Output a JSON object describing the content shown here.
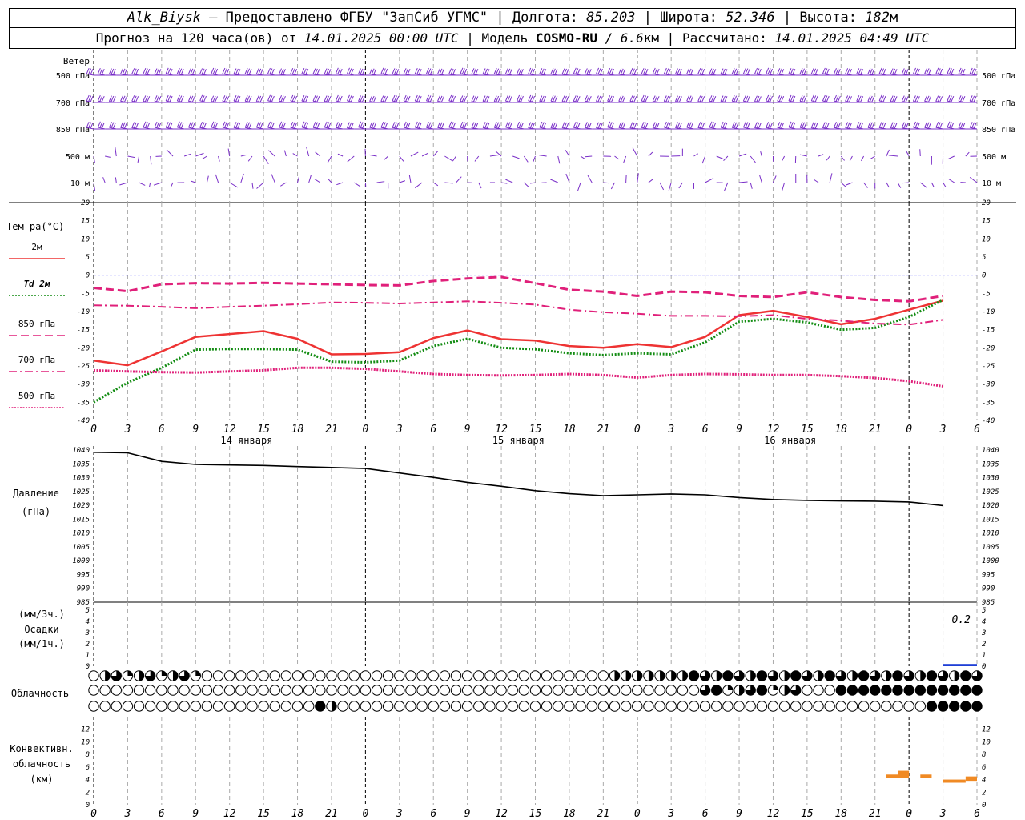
{
  "header": {
    "station": "Alk_Biysk",
    "provider": "— Предоставлено ФГБУ \"ЗапСиб УГМС\"",
    "sep": "|",
    "lon_label": "Долгота:",
    "lon": "85.203",
    "lat_label": "Широта:",
    "lat": "52.346",
    "alt_label": "Высота:",
    "alt": "182",
    "alt_unit": "м",
    "forecast_label": "Прогноз на 120 часа(ов) от",
    "forecast_start": "14.01.2025 00:00 UTC",
    "model_label": "| Модель",
    "model": "COSMO-RU",
    "model_res": "/ 6.6",
    "model_res_unit": "км",
    "calc_label": "| Рассчитано:",
    "calc_time": "14.01.2025 04:49 UTC"
  },
  "colors": {
    "wind": "#7a2fc8",
    "t2m": "#ee3333",
    "td2m": "#128c12",
    "t850": "#e0207a",
    "t700": "#e0207a",
    "t500": "#e0207a",
    "pressure": "#000000",
    "precip": "#1f3fd6",
    "convective": "#f08a24",
    "zero_line": "#3b3bff"
  },
  "chart_data": [
    {
      "type": "wind-barbs",
      "title": "Ветер",
      "levels": [
        "500 гПа",
        "700 гПа",
        "850 гПа",
        "500 м",
        "10 м"
      ],
      "note": "Wind barbs at 1-hour steps; strong westerly flow aloft, weak variable winds near surface"
    },
    {
      "type": "line",
      "ylabel": "Тем-ра(°C)",
      "ylim": [
        -40,
        20
      ],
      "yticks": [
        20,
        15,
        10,
        5,
        0,
        -5,
        -10,
        -15,
        -20,
        -25,
        -30,
        -35,
        -40
      ],
      "x": [
        0,
        3,
        6,
        9,
        12,
        15,
        18,
        21,
        24,
        27,
        30,
        33,
        36,
        39,
        42,
        45,
        48,
        51,
        54,
        57,
        60,
        63,
        66,
        69,
        72,
        75,
        78
      ],
      "x_tick_labels": [
        "0",
        "3",
        "6",
        "9",
        "12",
        "15",
        "18",
        "21",
        "0",
        "3",
        "6",
        "9",
        "12",
        "15",
        "18",
        "21",
        "0",
        "3",
        "6",
        "9",
        "12",
        "15",
        "18",
        "21",
        "0",
        "3",
        "6"
      ],
      "date_labels": [
        {
          "label": "14 января",
          "at": 13.5
        },
        {
          "label": "15 января",
          "at": 37.5
        },
        {
          "label": "16 января",
          "at": 61.5
        }
      ],
      "series": [
        {
          "name": "2м",
          "style": "solid",
          "values": [
            -23.5,
            -24.8,
            -21,
            -17,
            -16.2,
            -15.4,
            -17.5,
            -21.8,
            -21.7,
            -21.2,
            -17.3,
            -15.2,
            -17.6,
            -18,
            -19.5,
            -20,
            -19,
            -19.8,
            -17,
            -11,
            -9.8,
            -11.5,
            -13.5,
            -12,
            -9.5,
            -7
          ]
        },
        {
          "name": "Td 2м",
          "style": "dotted",
          "values": [
            -35,
            -29.6,
            -25.5,
            -20.5,
            -20.3,
            -20.3,
            -20.5,
            -23.8,
            -24,
            -23.5,
            -19.5,
            -17.5,
            -20,
            -20.4,
            -21.5,
            -22,
            -21.5,
            -21.8,
            -18.5,
            -12.8,
            -12,
            -13,
            -15,
            -14.5,
            -11.5,
            -6.8
          ]
        },
        {
          "name": "850 гПа",
          "style": "dashed",
          "values": [
            -3.5,
            -4.4,
            -2.5,
            -2.2,
            -2.3,
            -2.1,
            -2.3,
            -2.5,
            -2.7,
            -2.8,
            -1.6,
            -0.9,
            -0.5,
            -2.2,
            -4,
            -4.5,
            -5.7,
            -4.5,
            -4.7,
            -5.7,
            -6,
            -4.7,
            -6,
            -6.8,
            -7.2,
            -5.7
          ]
        },
        {
          "name": "700 гПа",
          "style": "dashdot",
          "values": [
            -8.3,
            -8.4,
            -8.7,
            -9.1,
            -8.7,
            -8.4,
            -8.0,
            -7.5,
            -7.6,
            -7.8,
            -7.5,
            -7.2,
            -7.6,
            -8.1,
            -9.5,
            -10.2,
            -10.6,
            -11.2,
            -11.2,
            -11.3,
            -11,
            -12,
            -12.5,
            -13.3,
            -13.6,
            -12.3
          ]
        },
        {
          "name": "500 гПа",
          "style": "densedot",
          "values": [
            -26.2,
            -26.5,
            -26.7,
            -26.8,
            -26.5,
            -26.2,
            -25.5,
            -25.5,
            -25.8,
            -26.5,
            -27.2,
            -27.5,
            -27.6,
            -27.5,
            -27.2,
            -27.5,
            -28.2,
            -27.5,
            -27.2,
            -27.3,
            -27.5,
            -27.5,
            -27.8,
            -28.3,
            -29.2,
            -30.6
          ]
        }
      ]
    },
    {
      "type": "line",
      "ylabel": "Давление",
      "yunit": "(гПа)",
      "ylim": [
        985,
        1040
      ],
      "yticks": [
        1040,
        1035,
        1030,
        1025,
        1020,
        1015,
        1010,
        1005,
        1000,
        995,
        990,
        985
      ],
      "series": [
        {
          "name": "pressure",
          "values": [
            1039.2,
            1039,
            1035.9,
            1034.8,
            1034.6,
            1034.4,
            1034,
            1033.7,
            1033.3,
            1031.7,
            1030.1,
            1028.3,
            1026.9,
            1025.3,
            1024.2,
            1023.5,
            1023.8,
            1024.1,
            1023.8,
            1022.8,
            1022.1,
            1021.8,
            1021.6,
            1021.5,
            1021.2,
            1019.9
          ]
        }
      ]
    },
    {
      "type": "bar",
      "ylabel": "(мм/3ч.)",
      "ylabel2": "Осадки",
      "ylabel3": "(мм/1ч.)",
      "ylim": [
        0,
        5
      ],
      "yticks": [
        5,
        4,
        3,
        2,
        1,
        0
      ],
      "annotation": "0.2",
      "values": [
        {
          "x": 75,
          "v": 0.2
        }
      ]
    },
    {
      "type": "cloud-cover",
      "ylabel": "Облачность",
      "rows": [
        "upper",
        "middle",
        "lower"
      ]
    },
    {
      "type": "bar",
      "ylabel": "Конвективн.",
      "ylabel2": "облачность",
      "ylabel3": "(км)",
      "ylim": [
        0,
        14
      ],
      "yticks": [
        12,
        10,
        8,
        6,
        4,
        2,
        0
      ],
      "bars": [
        {
          "x0": 70,
          "x1": 71,
          "lo": 4.3,
          "hi": 4.8
        },
        {
          "x0": 71,
          "x1": 72,
          "lo": 4.3,
          "hi": 5.4
        },
        {
          "x0": 73,
          "x1": 74,
          "lo": 4.3,
          "hi": 4.8
        },
        {
          "x0": 75,
          "x1": 77,
          "lo": 3.5,
          "hi": 4.0
        },
        {
          "x0": 77,
          "x1": 78,
          "lo": 3.8,
          "hi": 4.5
        }
      ]
    }
  ]
}
